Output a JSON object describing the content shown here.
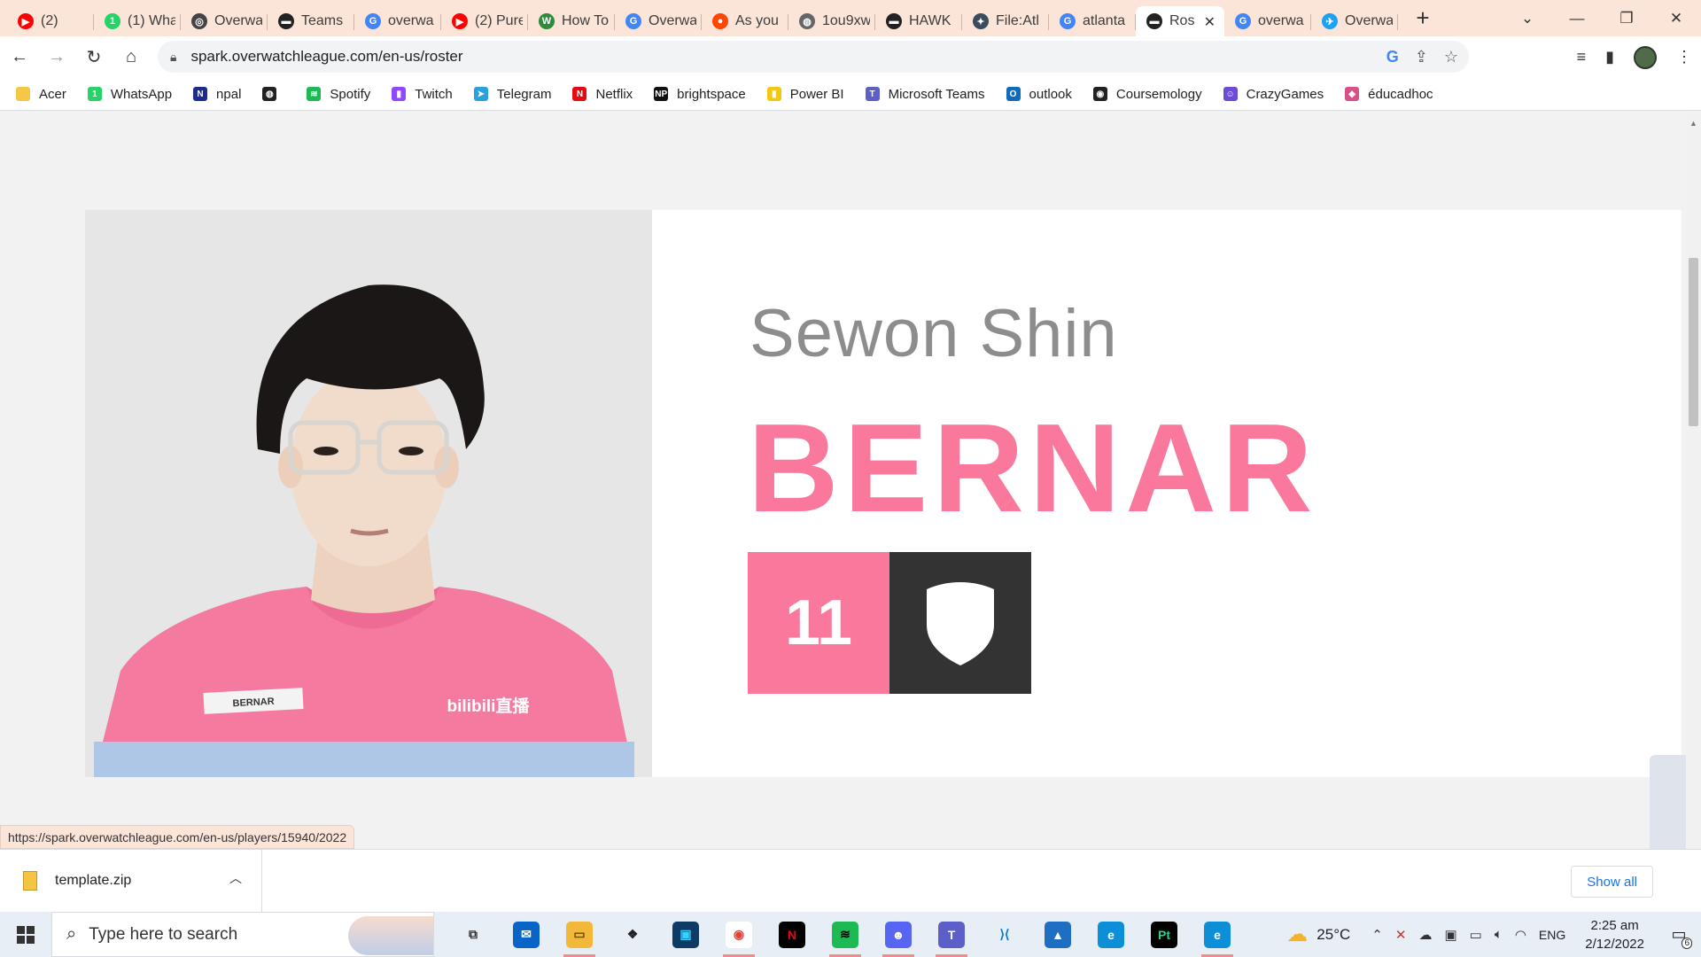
{
  "browser": {
    "tabs": [
      {
        "label": "(2)",
        "icon": "youtube-icon",
        "color": "#ff0000",
        "glyph": "▶"
      },
      {
        "label": "(1) Wha",
        "icon": "whatsapp-icon",
        "color": "#25d366",
        "glyph": "1"
      },
      {
        "label": "Overwa",
        "icon": "overwatch-icon",
        "color": "#444444",
        "glyph": "◎"
      },
      {
        "label": "Teams",
        "icon": "team-logo-icon",
        "color": "#222222",
        "glyph": "▬"
      },
      {
        "label": "overwa",
        "icon": "google-icon",
        "color": "#4285f4",
        "glyph": "G"
      },
      {
        "label": "(2) Pure",
        "icon": "youtube-icon",
        "color": "#ff0000",
        "glyph": "▶"
      },
      {
        "label": "How To",
        "icon": "wikihow-icon",
        "color": "#2f8a3c",
        "glyph": "W"
      },
      {
        "label": "Overwa",
        "icon": "google-icon",
        "color": "#4285f4",
        "glyph": "G"
      },
      {
        "label": "As you",
        "icon": "reddit-icon",
        "color": "#ff4500",
        "glyph": "●"
      },
      {
        "label": "1ou9xw",
        "icon": "globe-icon",
        "color": "#666666",
        "glyph": "◍"
      },
      {
        "label": "HAWK",
        "icon": "team-logo-icon",
        "color": "#222222",
        "glyph": "▬"
      },
      {
        "label": "File:Atl",
        "icon": "wiki-icon",
        "color": "#3a4b5c",
        "glyph": "✦"
      },
      {
        "label": "atlanta",
        "icon": "google-icon",
        "color": "#4285f4",
        "glyph": "G"
      },
      {
        "label": "Ros",
        "icon": "team-logo-icon",
        "color": "#222222",
        "glyph": "▬",
        "active": true
      },
      {
        "label": "overwa",
        "icon": "google-icon",
        "color": "#4285f4",
        "glyph": "G"
      },
      {
        "label": "Overwa",
        "icon": "twitter-icon",
        "color": "#1da1f2",
        "glyph": "✈"
      }
    ],
    "new_tab": "+",
    "window_controls": {
      "tab_search": "⌄",
      "minimize": "—",
      "restore": "❐",
      "close": "✕"
    },
    "url": "spark.overwatchleague.com/en-us/roster",
    "bookmarks": [
      {
        "label": "Acer",
        "color": "#f6c744",
        "glyph": ""
      },
      {
        "label": "WhatsApp",
        "color": "#25d366",
        "glyph": "1"
      },
      {
        "label": "npal",
        "color": "#1d2b8f",
        "glyph": "N"
      },
      {
        "label": "",
        "color": "#222222",
        "glyph": "◍"
      },
      {
        "label": "Spotify",
        "color": "#1db954",
        "glyph": "≋"
      },
      {
        "label": "Twitch",
        "color": "#9146ff",
        "glyph": "▮"
      },
      {
        "label": "Telegram",
        "color": "#2aa1da",
        "glyph": "➤"
      },
      {
        "label": "Netflix",
        "color": "#e50914",
        "glyph": "N"
      },
      {
        "label": "brightspace",
        "color": "#111111",
        "glyph": "NP"
      },
      {
        "label": "Power BI",
        "color": "#f2c811",
        "glyph": "▮"
      },
      {
        "label": "Microsoft Teams",
        "color": "#5b5fc7",
        "glyph": "T"
      },
      {
        "label": "outlook",
        "color": "#0f6cbd",
        "glyph": "O"
      },
      {
        "label": "Coursemology",
        "color": "#222222",
        "glyph": "◉"
      },
      {
        "label": "CrazyGames",
        "color": "#6c4bd8",
        "glyph": "☺"
      },
      {
        "label": "éducadhoc",
        "color": "#d94f8a",
        "glyph": "◆"
      }
    ],
    "status_url": "https://spark.overwatchleague.com/en-us/players/15940/2022"
  },
  "player": {
    "real_name": "Sewon Shin",
    "handle": "BERNAR",
    "number": "11",
    "role_icon": "tank-shield-icon",
    "jersey_nameplate": "BERNAR",
    "jersey_sponsor": "bilibili直播",
    "accent_color": "#f9789c",
    "dark_color": "#333333"
  },
  "downloads": {
    "file_name": "template.zip",
    "show_all": "Show all"
  },
  "taskbar": {
    "search_placeholder": "Type here to search",
    "apps": [
      {
        "name": "task-view-icon",
        "color": "#e8eef6",
        "glyph": "⧉",
        "fg": "#333"
      },
      {
        "name": "mail-icon",
        "color": "#0a64c8",
        "glyph": "✉",
        "fg": "#fff"
      },
      {
        "name": "file-explorer-icon",
        "color": "#f2b83a",
        "glyph": "▭",
        "fg": "#6b4a00",
        "running": true
      },
      {
        "name": "dropbox-icon",
        "color": "#e8eef6",
        "glyph": "❖",
        "fg": "#222"
      },
      {
        "name": "app-icon",
        "color": "#0d3b66",
        "glyph": "▣",
        "fg": "#38d0ff"
      },
      {
        "name": "chrome-icon",
        "color": "#ffffff",
        "glyph": "◉",
        "fg": "#db4437",
        "running": true
      },
      {
        "name": "netflix-icon",
        "color": "#000000",
        "glyph": "N",
        "fg": "#e50914"
      },
      {
        "name": "spotify-icon",
        "color": "#1db954",
        "glyph": "≋",
        "fg": "#000",
        "running": true
      },
      {
        "name": "discord-icon",
        "color": "#5865f2",
        "glyph": "☻",
        "fg": "#fff",
        "running": true
      },
      {
        "name": "teams-icon",
        "color": "#5b5fc7",
        "glyph": "T",
        "fg": "#fff",
        "running": true
      },
      {
        "name": "vscode-icon",
        "color": "#e8eef6",
        "glyph": "⟩⟨",
        "fg": "#007acc"
      },
      {
        "name": "photos-icon",
        "color": "#1e6fc2",
        "glyph": "▲",
        "fg": "#fff"
      },
      {
        "name": "edge-icon",
        "color": "#0c8fd6",
        "glyph": "e",
        "fg": "#fff"
      },
      {
        "name": "pycharm-icon",
        "color": "#000000",
        "glyph": "Pt",
        "fg": "#21d789"
      },
      {
        "name": "edge-dev-icon",
        "color": "#0c8fd6",
        "glyph": "e",
        "fg": "#fff",
        "running": true
      }
    ],
    "temperature": "25°C",
    "language": "ENG",
    "time": "2:25 am",
    "date": "2/12/2022",
    "notification_count": "6"
  }
}
